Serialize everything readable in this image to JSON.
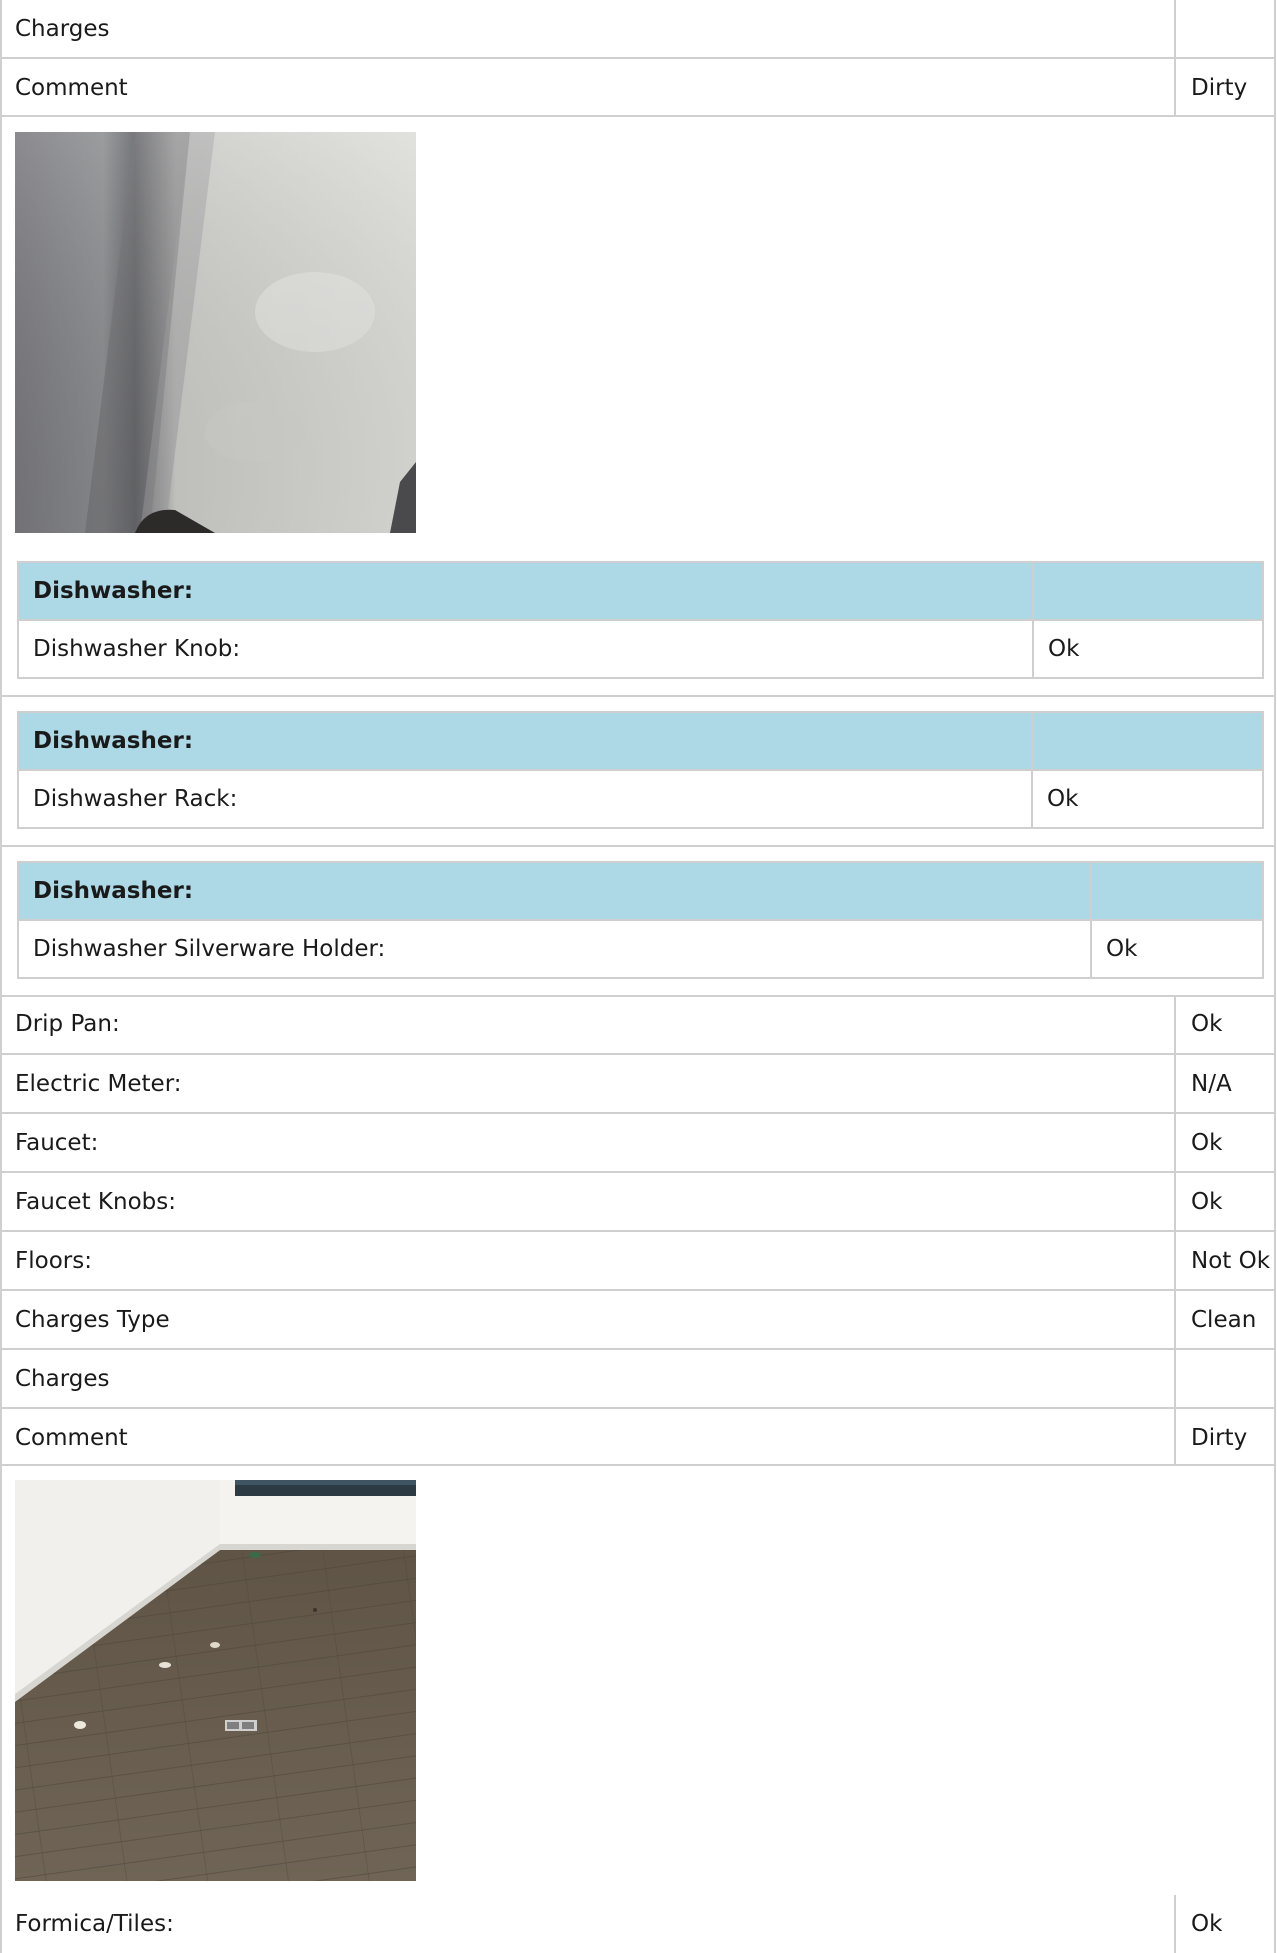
{
  "rows_top": [
    {
      "label": "Charges",
      "value": ""
    },
    {
      "label": "Comment",
      "value": "Dirty"
    }
  ],
  "photo1": {
    "alt": "Dirty surface photo"
  },
  "groups": [
    {
      "header": "Dishwasher:",
      "item": "Dishwasher Knob:",
      "value": "Ok"
    },
    {
      "header": "Dishwasher:",
      "item": "Dishwasher Rack:",
      "value": "Ok"
    },
    {
      "header": "Dishwasher:",
      "item": "Dishwasher Silverware Holder:",
      "value": "Ok"
    }
  ],
  "rows_mid": [
    {
      "label": "Drip Pan:",
      "value": "Ok"
    },
    {
      "label": "Electric Meter:",
      "value": "N/A"
    },
    {
      "label": "Faucet:",
      "value": "Ok"
    },
    {
      "label": "Faucet Knobs:",
      "value": "Ok"
    },
    {
      "label": "Floors:",
      "value": "Not Ok"
    },
    {
      "label": "Charges Type",
      "value": "Clean"
    },
    {
      "label": "Charges",
      "value": ""
    },
    {
      "label": "Comment",
      "value": "Dirty"
    }
  ],
  "photo2": {
    "alt": "Floor with debris photo"
  },
  "rows_bottom": [
    {
      "label": "Formica/Tiles:",
      "value": "Ok"
    }
  ]
}
